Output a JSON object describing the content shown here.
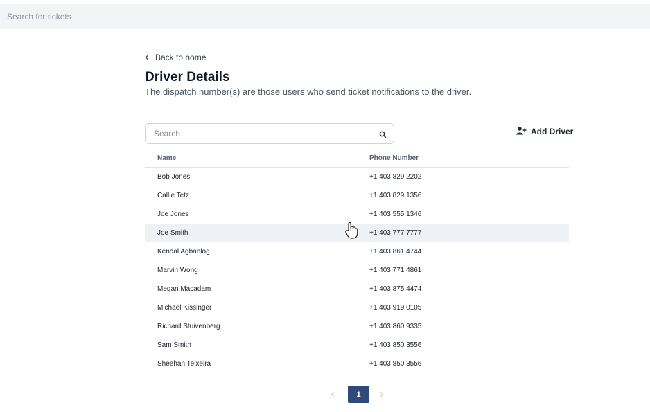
{
  "topbar": {
    "search_placeholder": "Search for tickets"
  },
  "back_link": {
    "label": "Back to home",
    "icon": "chevron-left-icon"
  },
  "page": {
    "title": "Driver Details",
    "subtitle": "The dispatch number(s) are those users who send ticket notifications to the driver."
  },
  "driver_search": {
    "placeholder": "Search",
    "icon": "search-icon"
  },
  "add_driver": {
    "label": "Add Driver",
    "icon": "user-plus-icon"
  },
  "table": {
    "columns": [
      "Name",
      "Phone Number"
    ],
    "rows": [
      {
        "name": "Bob Jones",
        "phone": "+1 403 829 2202"
      },
      {
        "name": "Callie Tetz",
        "phone": "+1 403 829 1356"
      },
      {
        "name": "Joe Jones",
        "phone": "+1 403 555 1346"
      },
      {
        "name": "Joe Smith",
        "phone": "+1 403 777 7777"
      },
      {
        "name": "Kendal Agbanlog",
        "phone": "+1 403 861 4744"
      },
      {
        "name": "Marvin Wong",
        "phone": "+1 403 771 4861"
      },
      {
        "name": "Megan Macadam",
        "phone": "+1 403 875 4474"
      },
      {
        "name": "Michael Kissinger",
        "phone": "+1 403 919 0105"
      },
      {
        "name": "Richard Stuivenberg",
        "phone": "+1 403 860 9335"
      },
      {
        "name": "Sam Smith",
        "phone": "+1 403 850 3556"
      },
      {
        "name": "Sheehan Teixeira",
        "phone": "+1 403 850 3556"
      }
    ],
    "hovered_row": "Joe Smith"
  },
  "pagination": {
    "current_page": "1",
    "prev_icon": "chevron-left-icon",
    "next_icon": "chevron-right-icon"
  },
  "colors": {
    "accent": "#2e4a7d",
    "hover_row": "#eef1f6",
    "topbar_bg": "#f3f4f6"
  }
}
